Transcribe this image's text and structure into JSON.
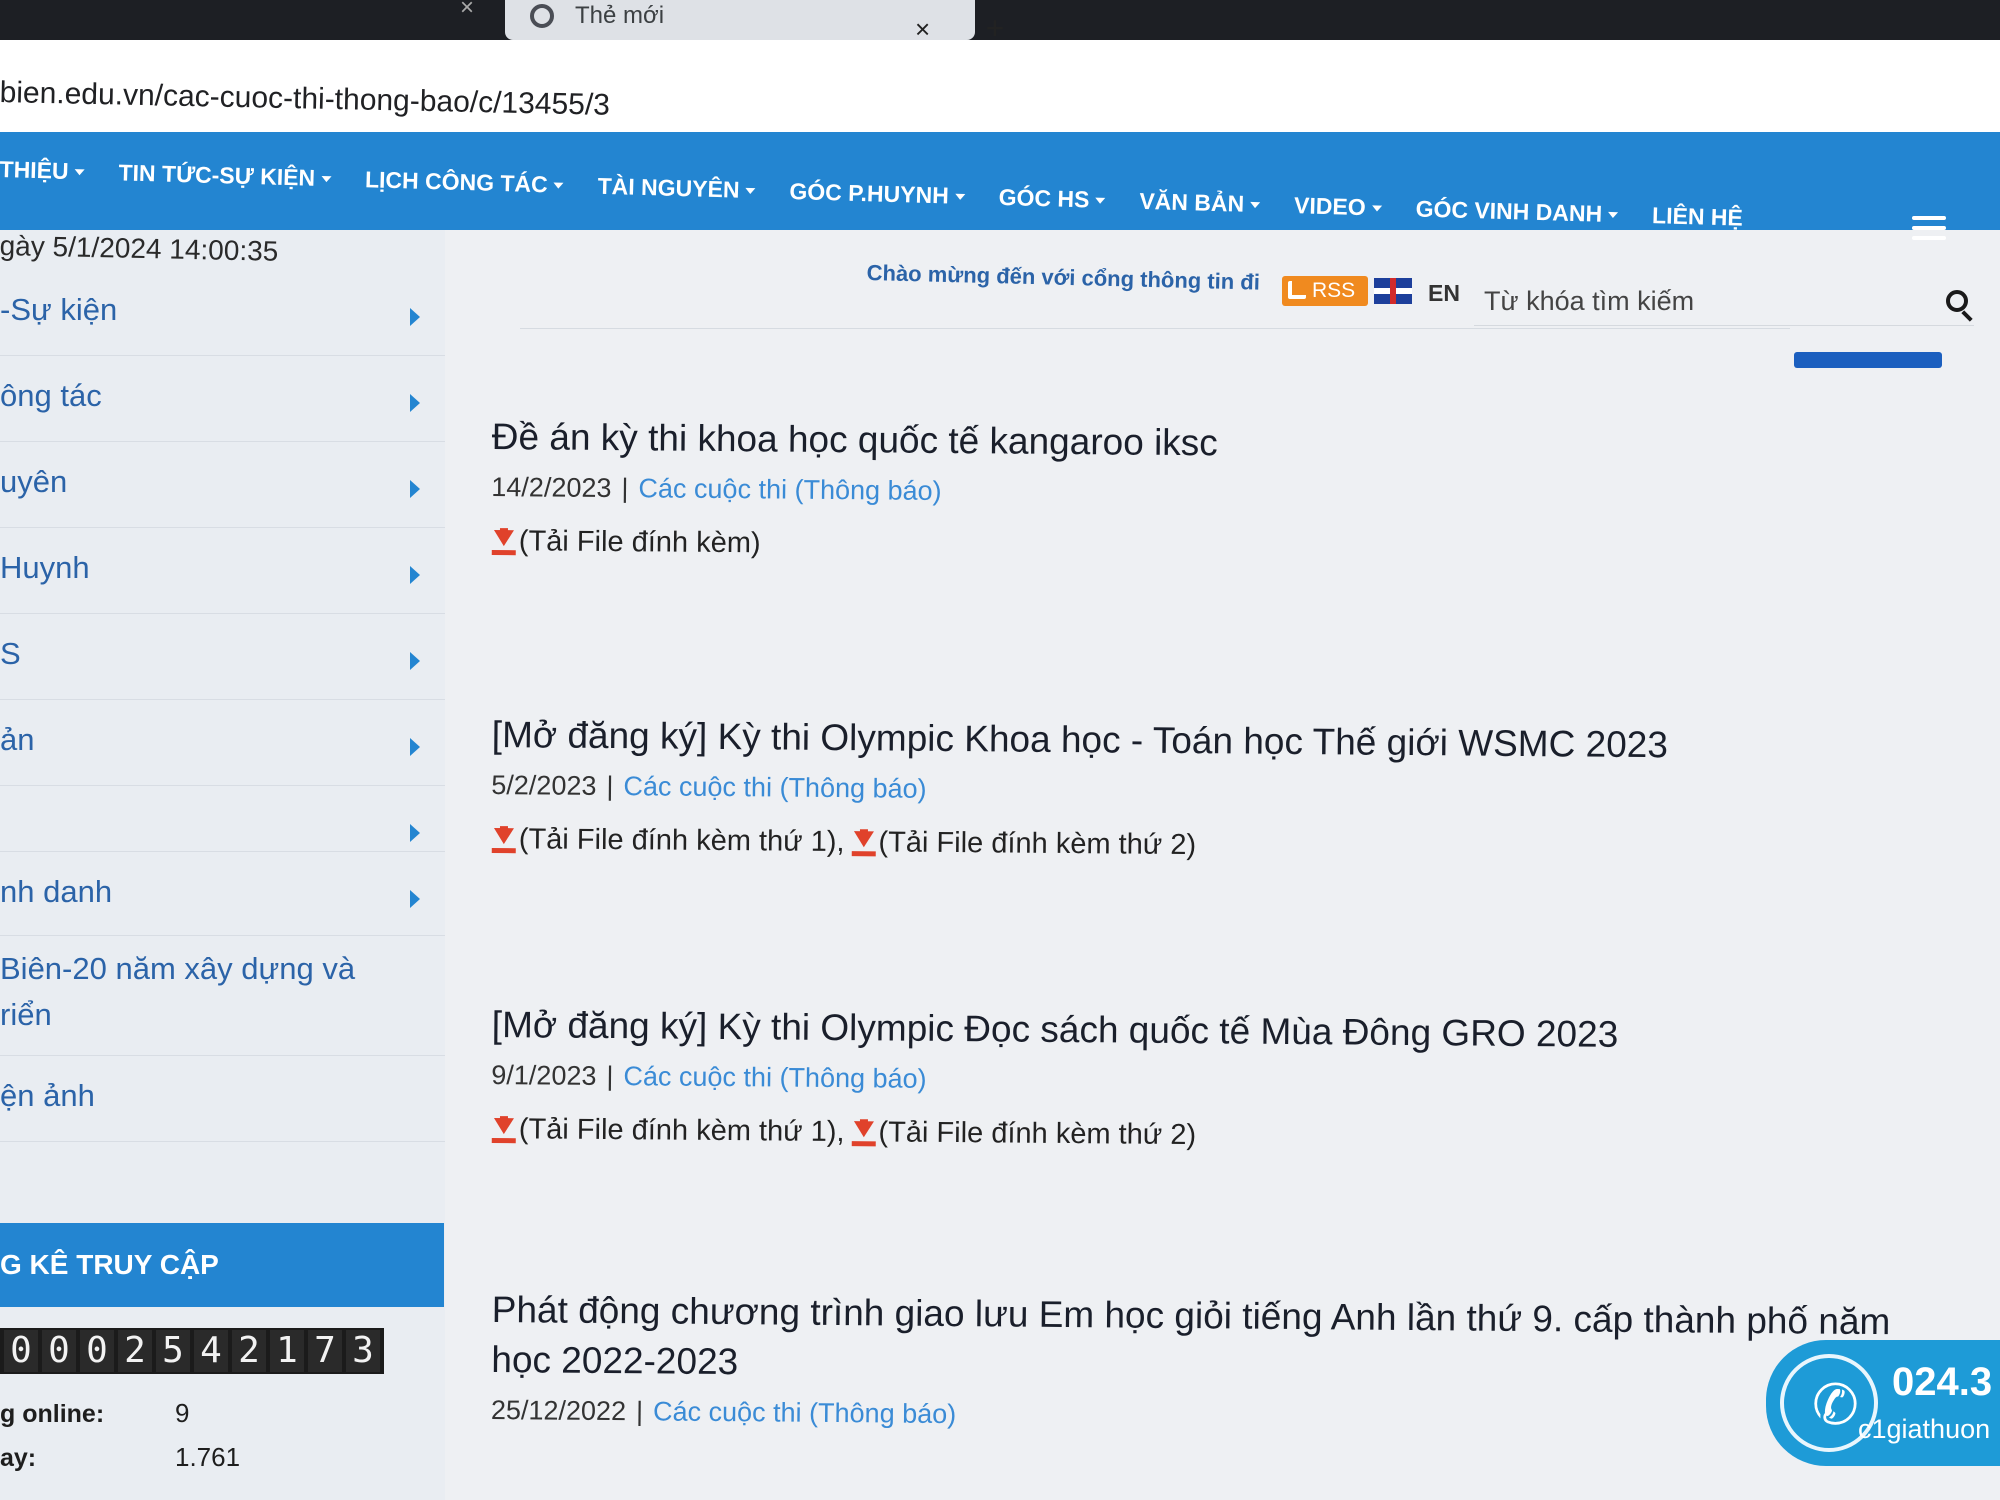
{
  "browser": {
    "tab_title": "Thẻ mới",
    "tab_close": "×",
    "new_tab": "+",
    "url": "bien.edu.vn/cac-cuoc-thi-thong-bao/c/13455/3"
  },
  "nav": {
    "items": [
      "THIỆU",
      "TIN TỨC-SỰ KIỆN",
      "LỊCH CÔNG TÁC",
      "TÀI NGUYÊN",
      "GÓC P.HUYNH",
      "GÓC HS",
      "VĂN BẢN",
      "VIDEO",
      "GÓC VINH DANH",
      "LIÊN HỆ"
    ]
  },
  "header": {
    "date_text": "gày 5/1/2024 14:00:35",
    "welcome": "Chào mừng đến với cổng thông tin đi",
    "rss": "RSS",
    "lang": "EN",
    "search_placeholder": "Từ khóa tìm kiếm"
  },
  "sidebar": {
    "items": [
      "-Sự kiện",
      "ông tác",
      "uyên",
      "Huynh",
      "S",
      "ản",
      "",
      "nh danh",
      "Biên-20 năm xây dựng và riển",
      "ện ảnh"
    ],
    "stats_title": "G KÊ TRUY CẬP",
    "counter": [
      "0",
      "0",
      "0",
      "2",
      "5",
      "4",
      "2",
      "1",
      "7",
      "3"
    ],
    "online_label": "g online:",
    "online_value": "9",
    "day_label": "ay:",
    "day_value": "1.761"
  },
  "articles": [
    {
      "title": "Đề án kỳ thi khoa học quốc tế kangaroo iksc",
      "date": "14/2/2023",
      "category": "Các cuộc thi (Thông báo)",
      "attachments": [
        "(Tải File đính kèm)"
      ]
    },
    {
      "title": "[Mở đăng ký] Kỳ thi Olympic Khoa học - Toán học Thế giới WSMC 2023",
      "date": "5/2/2023",
      "category": "Các cuộc thi (Thông báo)",
      "attachments": [
        "(Tải File đính kèm thứ 1)",
        "(Tải File đính kèm thứ 2)"
      ]
    },
    {
      "title": "[Mở đăng ký] Kỳ thi Olympic Đọc sách quốc tế Mùa Đông GRO 2023",
      "date": "9/1/2023",
      "category": "Các cuộc thi (Thông báo)",
      "attachments": [
        "(Tải File đính kèm thứ 1)",
        "(Tải File đính kèm thứ 2)"
      ]
    },
    {
      "title": "Phát động chương trình giao lưu Em học giỏi tiếng Anh lần thứ 9. cấp thành phố năm học 2022-2023",
      "date": "25/12/2022",
      "category": "Các cuộc thi (Thông báo)",
      "attachments": []
    }
  ],
  "contact": {
    "phone": "024.3",
    "name": "c1giathuon"
  },
  "colors": {
    "nav_blue": "#2385d1",
    "link_blue": "#3a8bd6",
    "download_red": "#e0422b"
  },
  "icons": {
    "search": "search-icon",
    "rss": "rss-icon",
    "download": "download-icon",
    "menu": "hamburger-menu-icon",
    "phone": "phone-icon"
  }
}
